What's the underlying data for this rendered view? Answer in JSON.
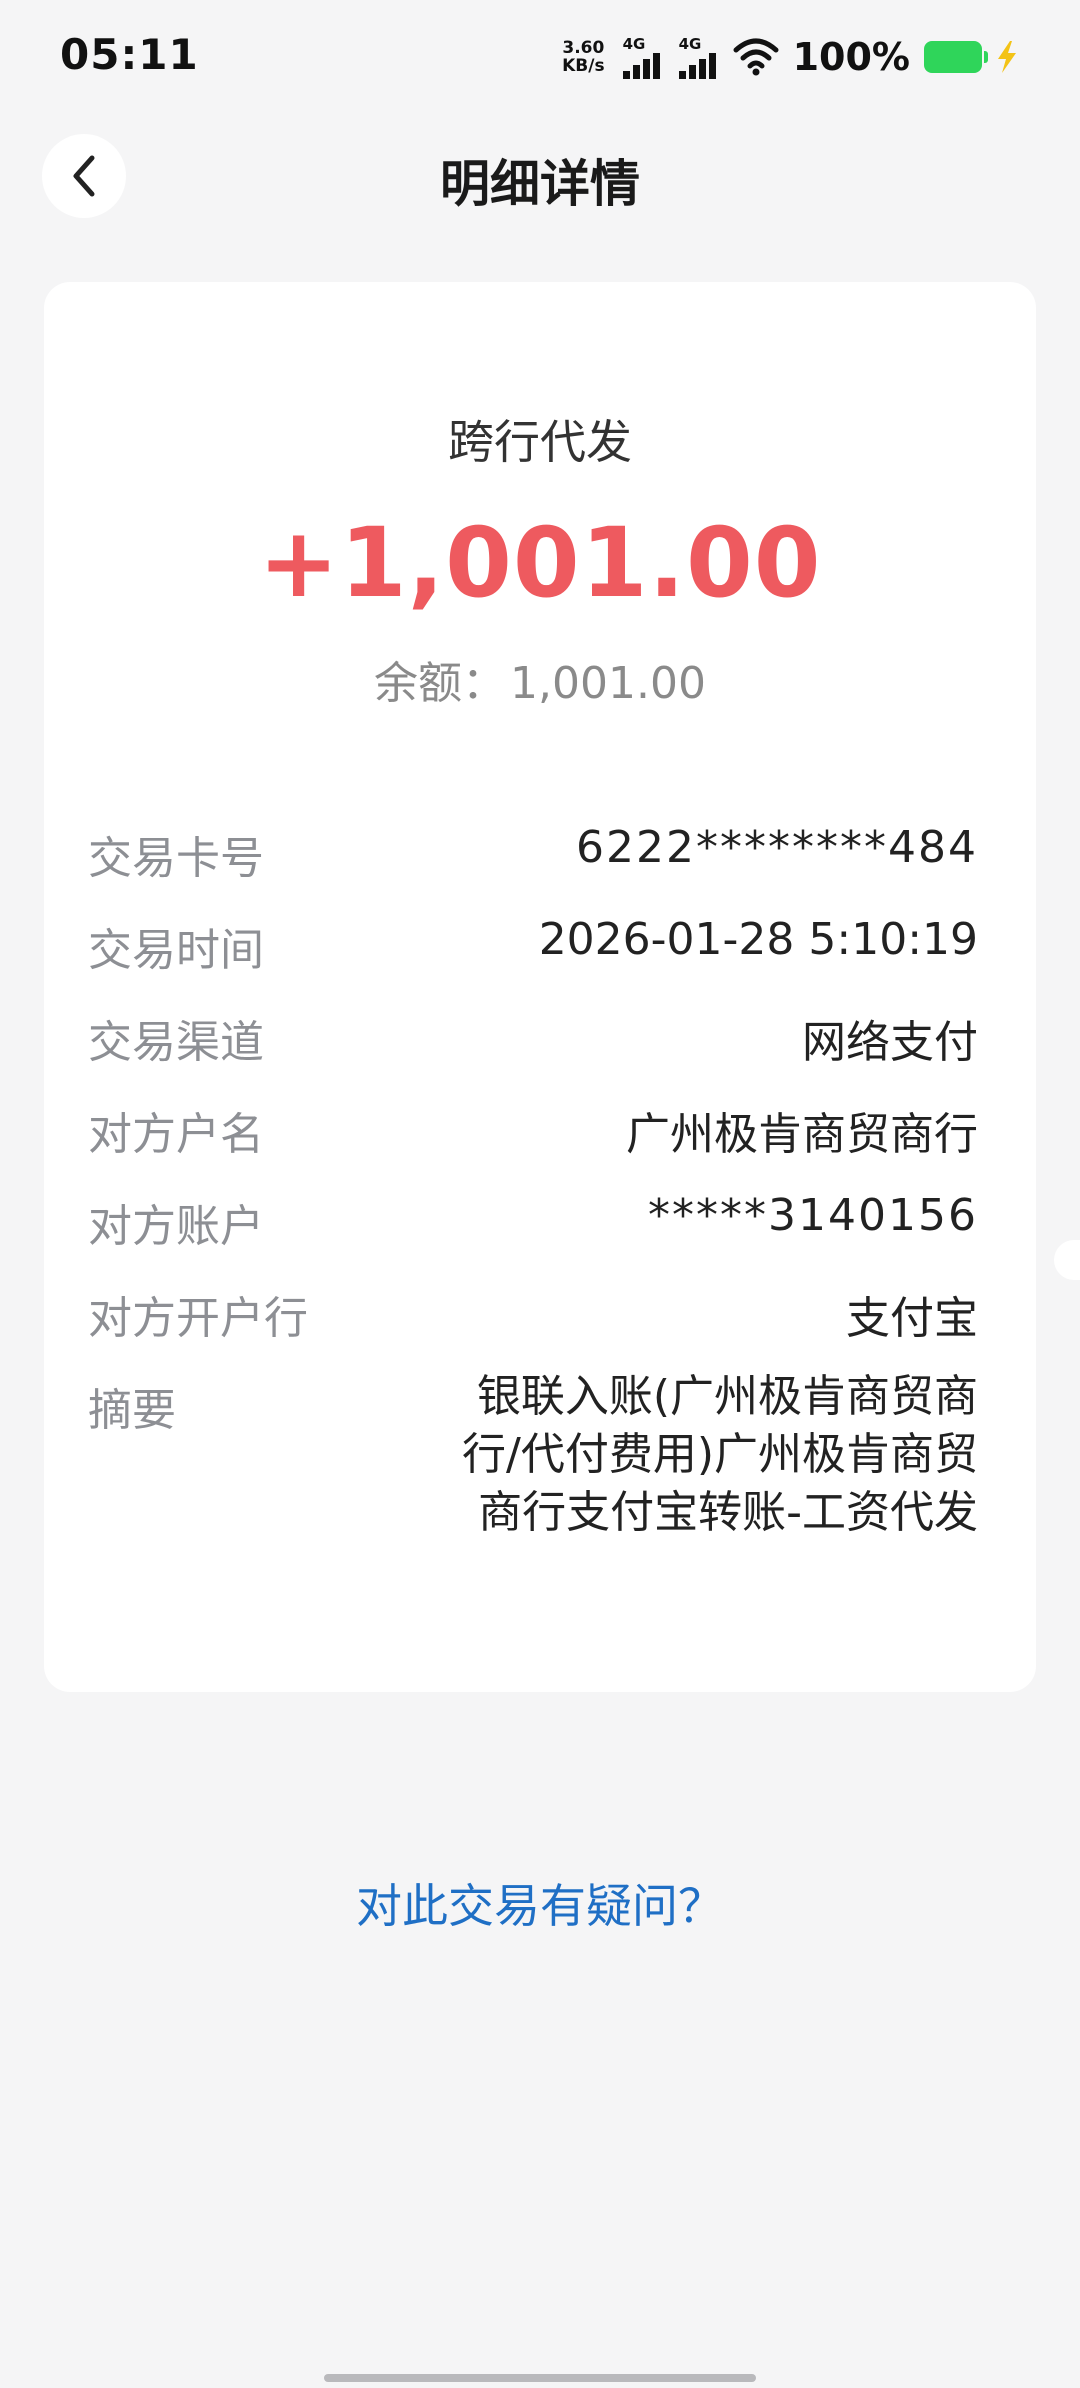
{
  "status_bar": {
    "time": "05:11",
    "net_speed_value": "3.60",
    "net_speed_unit": "KB/s",
    "network_type_1": "4G",
    "network_type_2": "4G",
    "battery_percent": "100%",
    "battery_color": "#2fd55a"
  },
  "header": {
    "back_icon": "chevron-left-icon",
    "title": "明细详情"
  },
  "transaction": {
    "type": "跨行代发",
    "amount": "+1,001.00",
    "amount_color": "#ee5a5f",
    "balance_label": "余额：",
    "balance_value": "1,001.00"
  },
  "details": [
    {
      "key": "交易卡号",
      "value": "6222********484"
    },
    {
      "key": "交易时间",
      "value": "2026-01-28 5:10:19"
    },
    {
      "key": "交易渠道",
      "value": "网络支付"
    },
    {
      "key": "对方户名",
      "value": "广州极肯商贸商行"
    },
    {
      "key": "对方账户",
      "value": "*****3140156"
    },
    {
      "key": "对方开户行",
      "value": "支付宝"
    },
    {
      "key": "摘要",
      "value": "银联入账(广州极肯商贸商行/代付费用)广州极肯商贸商行支付宝转账-工资代发"
    }
  ],
  "footer": {
    "query_link": "对此交易有疑问？",
    "link_color": "#1f6fc5"
  }
}
